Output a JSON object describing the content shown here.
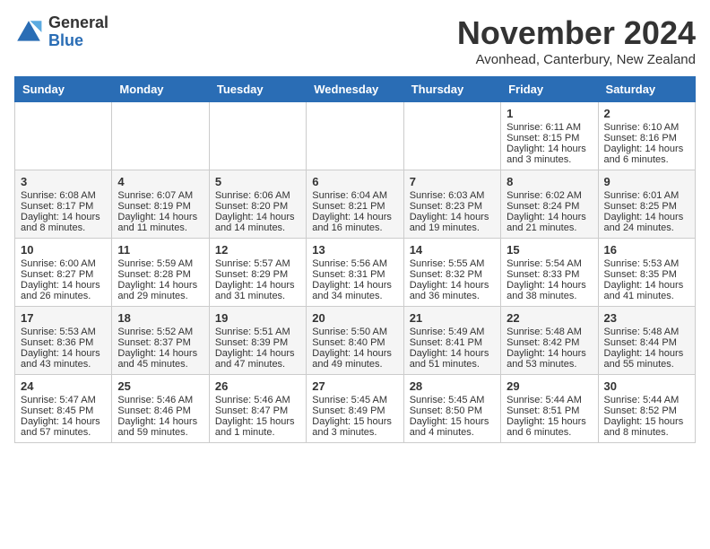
{
  "header": {
    "logo_general": "General",
    "logo_blue": "Blue",
    "month_title": "November 2024",
    "location": "Avonhead, Canterbury, New Zealand"
  },
  "weekdays": [
    "Sunday",
    "Monday",
    "Tuesday",
    "Wednesday",
    "Thursday",
    "Friday",
    "Saturday"
  ],
  "weeks": [
    [
      {
        "day": "",
        "info": ""
      },
      {
        "day": "",
        "info": ""
      },
      {
        "day": "",
        "info": ""
      },
      {
        "day": "",
        "info": ""
      },
      {
        "day": "",
        "info": ""
      },
      {
        "day": "1",
        "info": "Sunrise: 6:11 AM\nSunset: 8:15 PM\nDaylight: 14 hours and 3 minutes."
      },
      {
        "day": "2",
        "info": "Sunrise: 6:10 AM\nSunset: 8:16 PM\nDaylight: 14 hours and 6 minutes."
      }
    ],
    [
      {
        "day": "3",
        "info": "Sunrise: 6:08 AM\nSunset: 8:17 PM\nDaylight: 14 hours and 8 minutes."
      },
      {
        "day": "4",
        "info": "Sunrise: 6:07 AM\nSunset: 8:19 PM\nDaylight: 14 hours and 11 minutes."
      },
      {
        "day": "5",
        "info": "Sunrise: 6:06 AM\nSunset: 8:20 PM\nDaylight: 14 hours and 14 minutes."
      },
      {
        "day": "6",
        "info": "Sunrise: 6:04 AM\nSunset: 8:21 PM\nDaylight: 14 hours and 16 minutes."
      },
      {
        "day": "7",
        "info": "Sunrise: 6:03 AM\nSunset: 8:23 PM\nDaylight: 14 hours and 19 minutes."
      },
      {
        "day": "8",
        "info": "Sunrise: 6:02 AM\nSunset: 8:24 PM\nDaylight: 14 hours and 21 minutes."
      },
      {
        "day": "9",
        "info": "Sunrise: 6:01 AM\nSunset: 8:25 PM\nDaylight: 14 hours and 24 minutes."
      }
    ],
    [
      {
        "day": "10",
        "info": "Sunrise: 6:00 AM\nSunset: 8:27 PM\nDaylight: 14 hours and 26 minutes."
      },
      {
        "day": "11",
        "info": "Sunrise: 5:59 AM\nSunset: 8:28 PM\nDaylight: 14 hours and 29 minutes."
      },
      {
        "day": "12",
        "info": "Sunrise: 5:57 AM\nSunset: 8:29 PM\nDaylight: 14 hours and 31 minutes."
      },
      {
        "day": "13",
        "info": "Sunrise: 5:56 AM\nSunset: 8:31 PM\nDaylight: 14 hours and 34 minutes."
      },
      {
        "day": "14",
        "info": "Sunrise: 5:55 AM\nSunset: 8:32 PM\nDaylight: 14 hours and 36 minutes."
      },
      {
        "day": "15",
        "info": "Sunrise: 5:54 AM\nSunset: 8:33 PM\nDaylight: 14 hours and 38 minutes."
      },
      {
        "day": "16",
        "info": "Sunrise: 5:53 AM\nSunset: 8:35 PM\nDaylight: 14 hours and 41 minutes."
      }
    ],
    [
      {
        "day": "17",
        "info": "Sunrise: 5:53 AM\nSunset: 8:36 PM\nDaylight: 14 hours and 43 minutes."
      },
      {
        "day": "18",
        "info": "Sunrise: 5:52 AM\nSunset: 8:37 PM\nDaylight: 14 hours and 45 minutes."
      },
      {
        "day": "19",
        "info": "Sunrise: 5:51 AM\nSunset: 8:39 PM\nDaylight: 14 hours and 47 minutes."
      },
      {
        "day": "20",
        "info": "Sunrise: 5:50 AM\nSunset: 8:40 PM\nDaylight: 14 hours and 49 minutes."
      },
      {
        "day": "21",
        "info": "Sunrise: 5:49 AM\nSunset: 8:41 PM\nDaylight: 14 hours and 51 minutes."
      },
      {
        "day": "22",
        "info": "Sunrise: 5:48 AM\nSunset: 8:42 PM\nDaylight: 14 hours and 53 minutes."
      },
      {
        "day": "23",
        "info": "Sunrise: 5:48 AM\nSunset: 8:44 PM\nDaylight: 14 hours and 55 minutes."
      }
    ],
    [
      {
        "day": "24",
        "info": "Sunrise: 5:47 AM\nSunset: 8:45 PM\nDaylight: 14 hours and 57 minutes."
      },
      {
        "day": "25",
        "info": "Sunrise: 5:46 AM\nSunset: 8:46 PM\nDaylight: 14 hours and 59 minutes."
      },
      {
        "day": "26",
        "info": "Sunrise: 5:46 AM\nSunset: 8:47 PM\nDaylight: 15 hours and 1 minute."
      },
      {
        "day": "27",
        "info": "Sunrise: 5:45 AM\nSunset: 8:49 PM\nDaylight: 15 hours and 3 minutes."
      },
      {
        "day": "28",
        "info": "Sunrise: 5:45 AM\nSunset: 8:50 PM\nDaylight: 15 hours and 4 minutes."
      },
      {
        "day": "29",
        "info": "Sunrise: 5:44 AM\nSunset: 8:51 PM\nDaylight: 15 hours and 6 minutes."
      },
      {
        "day": "30",
        "info": "Sunrise: 5:44 AM\nSunset: 8:52 PM\nDaylight: 15 hours and 8 minutes."
      }
    ]
  ]
}
